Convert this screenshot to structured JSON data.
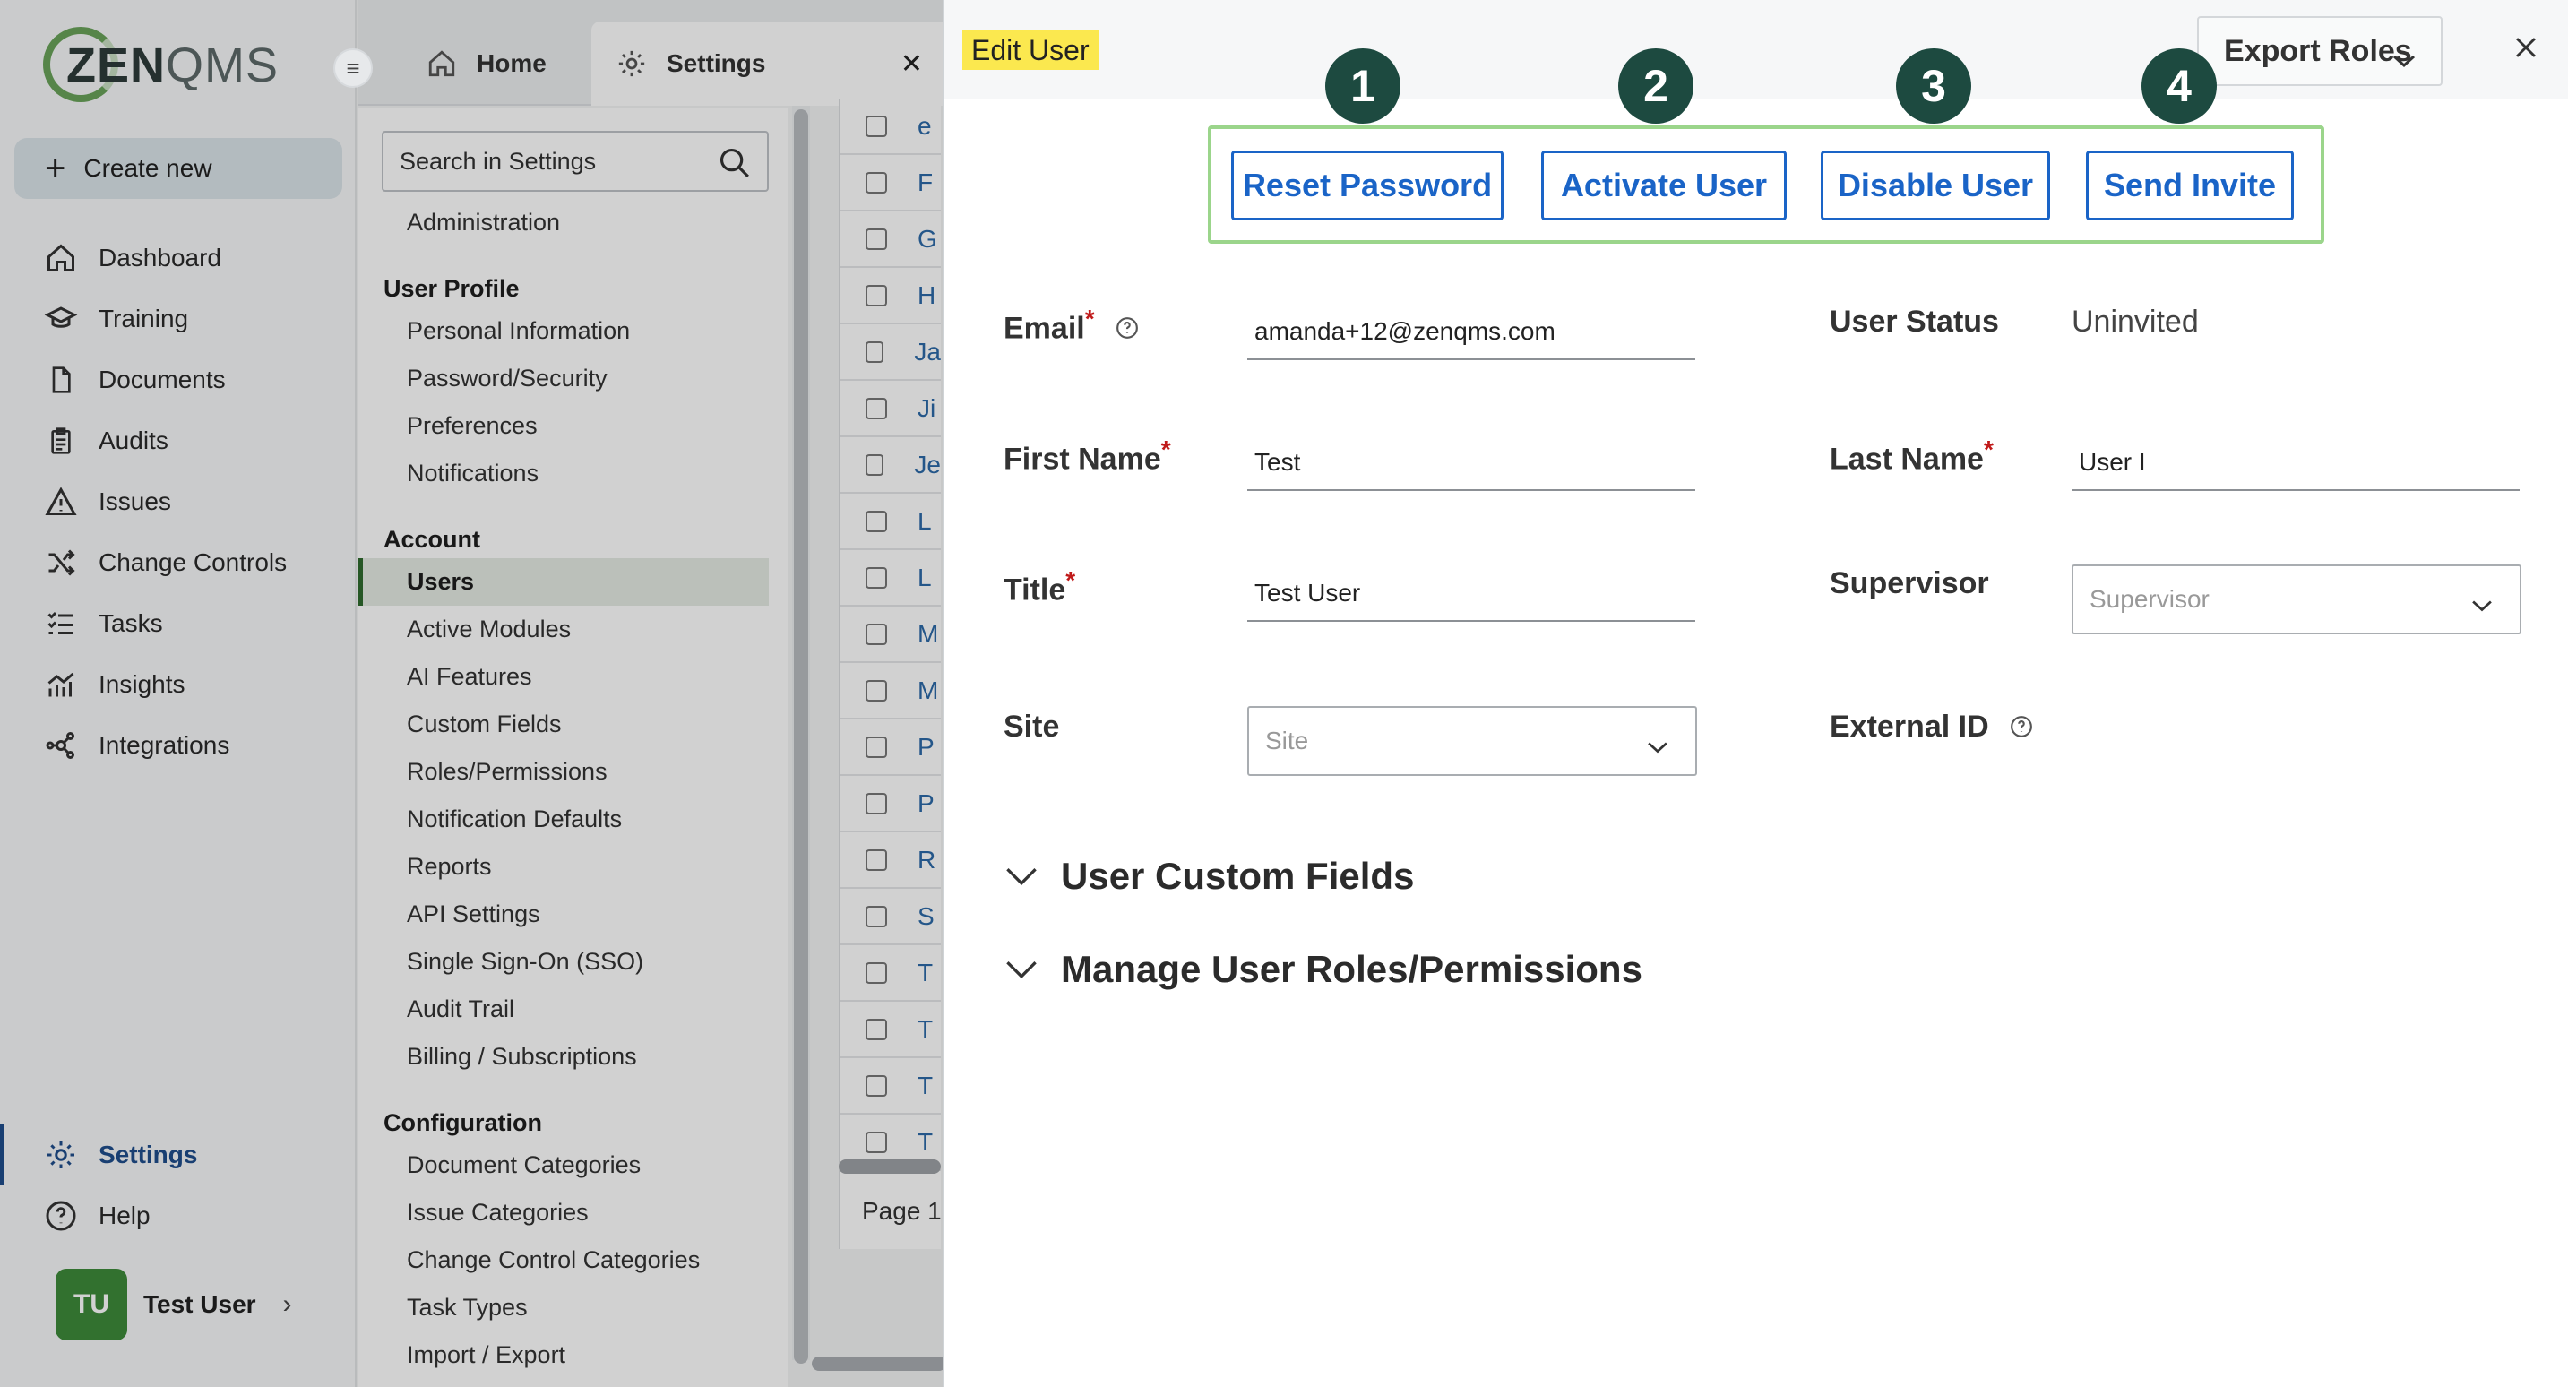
{
  "left_nav": {
    "logo": {
      "text_bold": "ZEN",
      "text_thin": "QMS"
    },
    "create_new": "Create new",
    "items": [
      {
        "label": "Dashboard",
        "icon": "home-icon"
      },
      {
        "label": "Training",
        "icon": "graduation-cap-icon"
      },
      {
        "label": "Documents",
        "icon": "document-icon"
      },
      {
        "label": "Audits",
        "icon": "clipboard-icon"
      },
      {
        "label": "Issues",
        "icon": "warning-icon"
      },
      {
        "label": "Change Controls",
        "icon": "shuffle-icon"
      },
      {
        "label": "Tasks",
        "icon": "checklist-icon"
      },
      {
        "label": "Insights",
        "icon": "chart-icon"
      },
      {
        "label": "Integrations",
        "icon": "network-icon"
      }
    ],
    "bottom_items": [
      {
        "label": "Settings",
        "icon": "gear-icon",
        "active": true
      },
      {
        "label": "Help",
        "icon": "help-circle-icon"
      }
    ],
    "user": {
      "initials": "TU",
      "name": "Test User"
    }
  },
  "tabs": [
    {
      "label": "Home",
      "icon": "home-icon"
    },
    {
      "label": "Settings",
      "icon": "gear-icon",
      "active": true
    }
  ],
  "settings_menu": {
    "search_placeholder": "Search in Settings",
    "administration": "Administration",
    "groups": [
      {
        "heading": "User Profile",
        "items": [
          "Personal Information",
          "Password/Security",
          "Preferences",
          "Notifications"
        ]
      },
      {
        "heading": "Account",
        "items": [
          "Users",
          "Active Modules",
          "AI Features",
          "Custom Fields",
          "Roles/Permissions",
          "Notification Defaults",
          "Reports",
          "API Settings",
          "Single Sign-On (SSO)",
          "Audit Trail",
          "Billing / Subscriptions"
        ]
      },
      {
        "heading": "Configuration",
        "items": [
          "Document Categories",
          "Issue Categories",
          "Change Control Categories",
          "Task Types",
          "Import / Export"
        ]
      }
    ],
    "selected": "Users"
  },
  "background_table": {
    "row_initials": [
      "e",
      "F",
      "G",
      "H",
      "Ja",
      "Ji",
      "Je",
      "L",
      "L",
      "M",
      "M",
      "P",
      "P",
      "R",
      "S",
      "T",
      "T",
      "T",
      "T"
    ],
    "page_label": "Page 1"
  },
  "drawer": {
    "title": "Edit User",
    "export_roles": "Export Roles",
    "callouts": [
      "1",
      "2",
      "3",
      "4"
    ],
    "actions": [
      "Reset Password",
      "Activate User",
      "Disable User",
      "Send Invite"
    ],
    "fields": {
      "email": {
        "label": "Email",
        "value": "amanda+12@zenqms.com"
      },
      "user_status": {
        "label": "User Status",
        "value": "Uninvited"
      },
      "first_name": {
        "label": "First Name",
        "value": "Test"
      },
      "last_name": {
        "label": "Last Name",
        "value": "User I"
      },
      "title": {
        "label": "Title",
        "value": "Test User"
      },
      "supervisor": {
        "label": "Supervisor",
        "placeholder": "Supervisor"
      },
      "site": {
        "label": "Site",
        "placeholder": "Site"
      },
      "external_id": {
        "label": "External ID"
      }
    },
    "sections": [
      "User Custom Fields",
      "Manage User Roles/Permissions"
    ]
  },
  "colors": {
    "accent_blue": "#1a64c7",
    "callout_green": "#1d4a40",
    "highlight_box": "#9bd58b",
    "title_highlight": "#fbe84f",
    "required_red": "#c01a1a"
  }
}
